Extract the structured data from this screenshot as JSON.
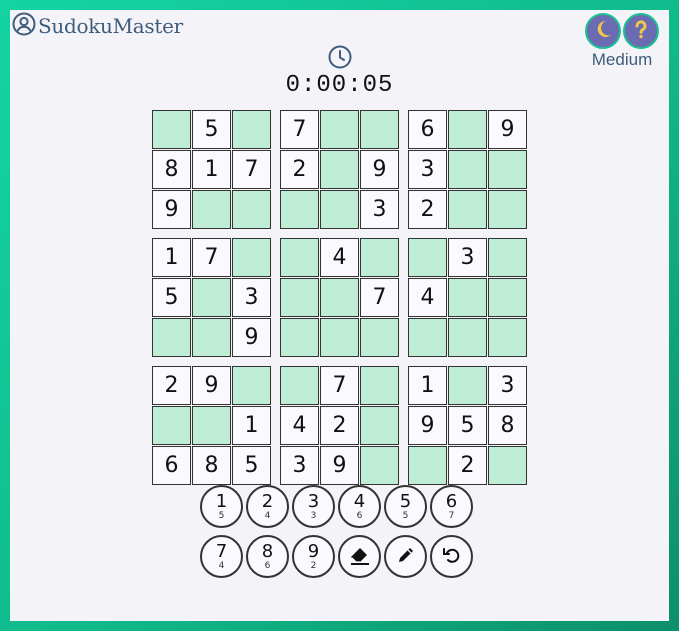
{
  "app": {
    "brand": "SudokuMaster",
    "difficulty": "Medium"
  },
  "timer": {
    "value": "0:00:05"
  },
  "icons": {
    "user": "user-circle-icon",
    "theme": "moon-icon",
    "help": "question-icon",
    "clock": "clock-icon",
    "erase": "eraser-icon",
    "pencil": "pencil-icon",
    "undo": "undo-icon"
  },
  "colors": {
    "frame": "#10b98a",
    "empty_cell": "#bfecd4",
    "button_accent": "#6b6bb2",
    "text_blue": "#3f5c7d"
  },
  "board": {
    "rows": [
      [
        "",
        "5",
        "",
        "7",
        "",
        "",
        "6",
        "",
        "9"
      ],
      [
        "8",
        "1",
        "7",
        "2",
        "",
        "9",
        "3",
        "",
        ""
      ],
      [
        "9",
        "",
        "",
        "",
        "",
        "3",
        "2",
        "",
        ""
      ],
      [
        "1",
        "7",
        "",
        "",
        "4",
        "",
        "",
        "3",
        ""
      ],
      [
        "5",
        "",
        "3",
        "",
        "",
        "7",
        "4",
        "",
        ""
      ],
      [
        "",
        "",
        "9",
        "",
        "",
        "",
        "",
        "",
        ""
      ],
      [
        "2",
        "9",
        "",
        "",
        "7",
        "",
        "1",
        "",
        "3"
      ],
      [
        "",
        "",
        "1",
        "4",
        "2",
        "",
        "9",
        "5",
        "8"
      ],
      [
        "6",
        "8",
        "5",
        "3",
        "9",
        "",
        "",
        "2",
        ""
      ]
    ]
  },
  "numpad": {
    "digits": [
      {
        "n": "1",
        "c": "5"
      },
      {
        "n": "2",
        "c": "4"
      },
      {
        "n": "3",
        "c": "3"
      },
      {
        "n": "4",
        "c": "6"
      },
      {
        "n": "5",
        "c": "5"
      },
      {
        "n": "6",
        "c": "7"
      },
      {
        "n": "7",
        "c": "4"
      },
      {
        "n": "8",
        "c": "6"
      },
      {
        "n": "9",
        "c": "2"
      }
    ]
  }
}
